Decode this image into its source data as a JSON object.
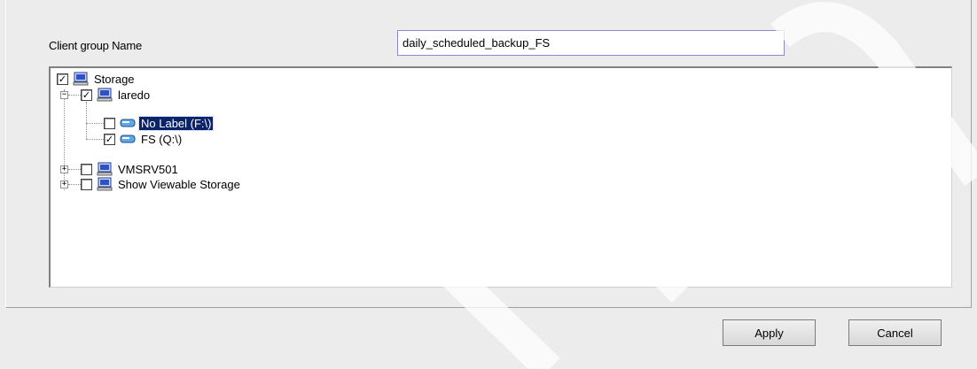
{
  "form": {
    "group_name_label": "Client group Name",
    "group_name_value": "daily_scheduled_backup_FS"
  },
  "tree": {
    "root": {
      "label": "Storage",
      "checked": true
    },
    "laredo": {
      "label": "laredo",
      "checked": true,
      "expanded": true
    },
    "no_label": {
      "label": "No Label (F:\\)",
      "checked": false,
      "selected": true
    },
    "fs": {
      "label": "FS (Q:\\)",
      "checked": true
    },
    "vmsrv": {
      "label": "VMSRV501",
      "checked": false,
      "expanded": false
    },
    "viewable": {
      "label": "Show Viewable Storage",
      "checked": false,
      "expanded": false
    }
  },
  "buttons": {
    "apply": "Apply",
    "cancel": "Cancel"
  },
  "icons": {
    "computer": "computer-icon",
    "drive": "drive-icon"
  },
  "colors": {
    "selection": "#0a246a",
    "input_border": "#8a8aca",
    "monitor": "#3050c8"
  }
}
